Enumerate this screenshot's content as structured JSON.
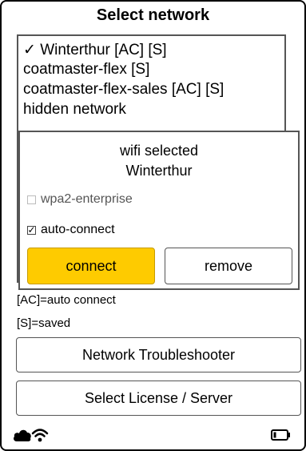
{
  "title": "Select network",
  "networks": [
    {
      "label": "✓ Winterthur [AC] [S]",
      "selected": true
    },
    {
      "label": "coatmaster-flex [S]"
    },
    {
      "label": "coatmaster-flex-sales [AC] [S]"
    },
    {
      "label": "hidden network"
    }
  ],
  "dialog": {
    "heading": "wifi selected",
    "ssid": "Winterthur",
    "options": [
      {
        "label": "wpa2-enterprise",
        "checked": false,
        "enabled": false
      },
      {
        "label": "auto-connect",
        "checked": true,
        "enabled": true
      }
    ],
    "connect_label": "connect",
    "remove_label": "remove",
    "accent_color": "#fecb00"
  },
  "legend": {
    "ac": "[AC]=auto connect",
    "s": "[S]=saved"
  },
  "troubleshooter_label": "Network Troubleshooter",
  "license_label": "Select License / Server",
  "status": {
    "icons": [
      "cloud-icon",
      "wifi-icon",
      "battery-icon"
    ]
  }
}
